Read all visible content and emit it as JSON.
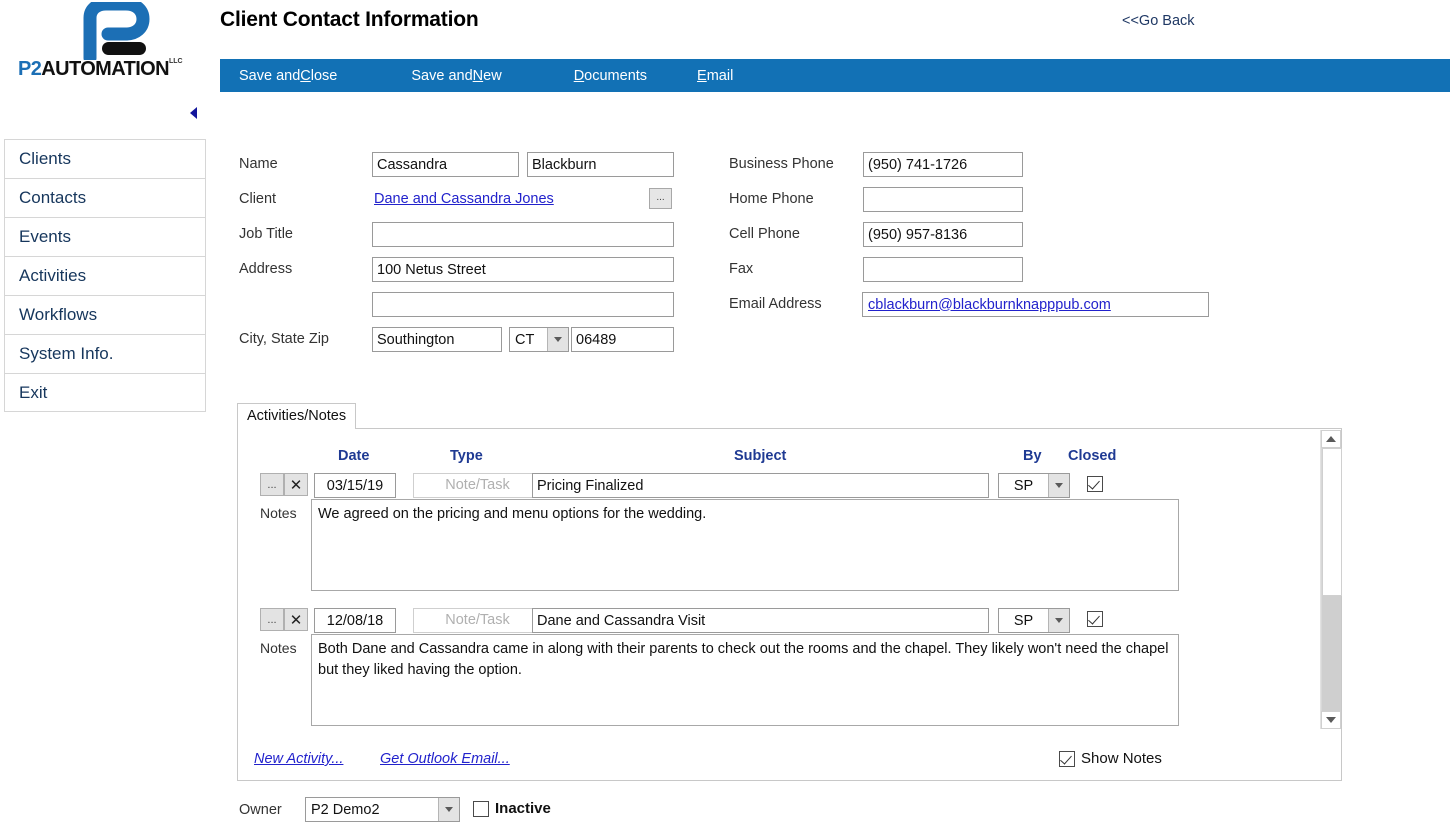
{
  "brand": {
    "logo_p2": "P2",
    "logo_automation": "AUTOMATION",
    "logo_tm": "LLC"
  },
  "header": {
    "title": "Client Contact Information",
    "go_back": "<<Go Back"
  },
  "toolbar": {
    "items": [
      {
        "pre": "Save and ",
        "accel": "C",
        "post": "lose"
      },
      {
        "pre": "Save and ",
        "accel": "N",
        "post": "ew"
      },
      {
        "pre": "",
        "accel": "D",
        "post": "ocuments"
      },
      {
        "pre": "",
        "accel": "E",
        "post": "mail"
      }
    ],
    "labels": [
      "Save and Close",
      "Save and New",
      "Documents",
      "Email"
    ]
  },
  "sidebar": {
    "items": [
      {
        "label": "Clients"
      },
      {
        "label": "Contacts"
      },
      {
        "label": "Events"
      },
      {
        "label": "Activities"
      },
      {
        "label": "Workflows"
      },
      {
        "label": "System Info."
      },
      {
        "label": "Exit"
      }
    ]
  },
  "form": {
    "labels": {
      "name": "Name",
      "client": "Client",
      "job_title": "Job Title",
      "address": "Address",
      "city_state_zip": "City, State Zip",
      "business_phone": "Business Phone",
      "home_phone": "Home Phone",
      "cell_phone": "Cell Phone",
      "fax": "Fax",
      "email_address": "Email Address"
    },
    "values": {
      "first_name": "Cassandra",
      "last_name": "Blackburn",
      "client": "Dane and Cassandra Jones",
      "job_title": "",
      "address1": "100 Netus Street",
      "address2": "",
      "city": "Southington",
      "state": "CT",
      "zip": "06489",
      "business_phone": "(950) 741-1726",
      "home_phone": "",
      "cell_phone": "(950) 957-8136",
      "fax": "",
      "email": "cblackburn@blackburnknapppub.com"
    },
    "lookup_button": "..."
  },
  "tabs": {
    "active": "Activities/Notes",
    "items": [
      {
        "label": "Activities/Notes"
      }
    ]
  },
  "grid": {
    "columns": [
      "Date",
      "Type",
      "Subject",
      "By",
      "Closed"
    ],
    "notes_label": "Notes",
    "type_placeholder": "Note/Task",
    "row_lookup_button": "...",
    "row_delete_button": "✕",
    "rows": [
      {
        "date": "03/15/19",
        "type": "Note/Task",
        "subject": "Pricing Finalized",
        "by": "SP",
        "closed": true,
        "notes": "We agreed on the pricing and menu options for the wedding."
      },
      {
        "date": "12/08/18",
        "type": "Note/Task",
        "subject": "Dane and Cassandra Visit",
        "by": "SP",
        "closed": true,
        "notes": "Both Dane and Cassandra came in along with their parents to check out the rooms and the chapel.  They likely won't need the chapel but they liked having the option."
      }
    ]
  },
  "footer": {
    "new_activity": "New Activity...",
    "get_outlook_email": "Get Outlook Email...",
    "show_notes_label": "Show Notes",
    "show_notes_checked": true,
    "owner_label": "Owner",
    "owner_value": "P2 Demo2",
    "inactive_label": "Inactive",
    "inactive_checked": false
  },
  "colors": {
    "toolbar_blue": "#1271b5",
    "brand_blue": "#1c6fb5",
    "link_blue": "#2222cc",
    "header_navy": "#1f3a93",
    "nav_text": "#16365c"
  }
}
